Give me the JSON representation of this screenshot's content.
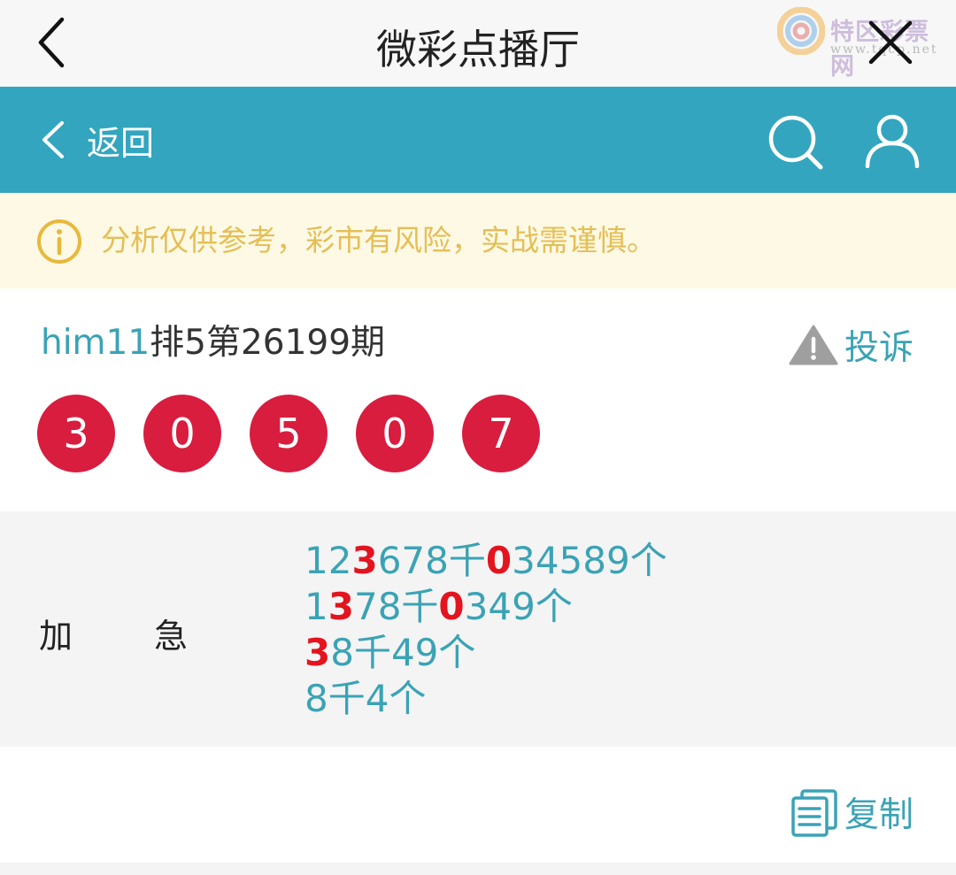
{
  "titlebar": {
    "title": "微彩点播厅",
    "watermark_text": "特区彩票网",
    "watermark_sub": "www.tqcp.net",
    "back_icon": "chevron-left-icon",
    "close_icon": "close-icon"
  },
  "navbar": {
    "back_label": "返回",
    "search_icon": "search-icon",
    "user_icon": "user-icon",
    "background_color": "#33a5bf"
  },
  "notice": {
    "text": "分析仅供参考，彩市有风险，实战需谨慎。",
    "icon": "info-icon",
    "color": "#e5be55"
  },
  "issue": {
    "user": "him11",
    "label": "排5第26199期",
    "report_label": "投诉",
    "report_icon": "warning-icon"
  },
  "balls": [
    "3",
    "0",
    "5",
    "0",
    "7"
  ],
  "ball_color": "#d81d3f",
  "prediction": {
    "key_1": "加",
    "key_2": "急",
    "lines": [
      [
        {
          "t": "12",
          "h": false
        },
        {
          "t": "3",
          "h": true
        },
        {
          "t": "678千",
          "h": false
        },
        {
          "t": "0",
          "h": true
        },
        {
          "t": "34589个",
          "h": false
        }
      ],
      [
        {
          "t": "1",
          "h": false
        },
        {
          "t": "3",
          "h": true
        },
        {
          "t": "78千",
          "h": false
        },
        {
          "t": "0",
          "h": true
        },
        {
          "t": "349个",
          "h": false
        }
      ],
      [
        {
          "t": "3",
          "h": true
        },
        {
          "t": "8千49个",
          "h": false
        }
      ],
      [
        {
          "t": "8千4个",
          "h": false
        }
      ]
    ],
    "highlight_color": "#e3141f",
    "text_color": "#3aa3b5"
  },
  "copy": {
    "label": "复制",
    "icon": "copy-icon"
  }
}
